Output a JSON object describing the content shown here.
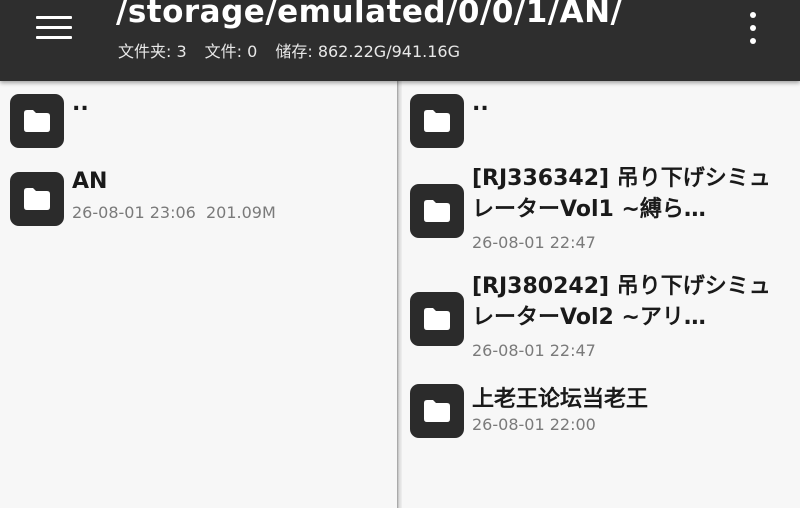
{
  "header": {
    "path": "/storage/emulated/0/0/1/AN/",
    "folders_label": "文件夹: 3",
    "files_label": "文件: 0",
    "storage_label": "储存: 862.22G/941.16G"
  },
  "icons": {
    "menu": "menu-icon",
    "more": "more-vert-icon",
    "folder": "folder-icon"
  },
  "colors": {
    "appbar": "#2e2e2e",
    "folder_tile": "#2b2b2b",
    "meta_text": "#7a7a7a"
  },
  "left_pane": {
    "parent": "..",
    "items": [
      {
        "name": "AN",
        "date": "26-08-01 23:06",
        "size": "201.09M"
      }
    ]
  },
  "right_pane": {
    "parent": "..",
    "items": [
      {
        "name": "[RJ336342] 吊り下げシミュレーターVol1 ~縛ら…",
        "date": "26-08-01 22:47"
      },
      {
        "name": "[RJ380242] 吊り下げシミュレーターVol2 ~アリ…",
        "date": "26-08-01 22:47"
      },
      {
        "name": "上老王论坛当老王",
        "date": "26-08-01 22:00"
      }
    ]
  }
}
